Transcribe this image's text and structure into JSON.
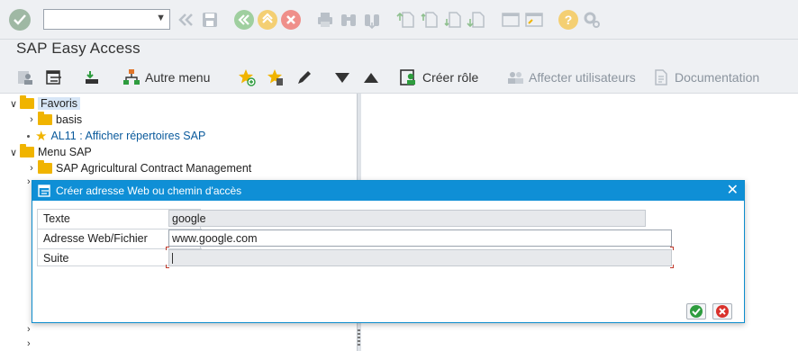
{
  "app": {
    "title": "SAP Easy Access"
  },
  "systoolbar": {
    "command_value": "",
    "icons": [
      "enter-icon",
      "back-icon",
      "save-icon",
      "back-green-icon",
      "exit-icon",
      "cancel-icon",
      "print-icon",
      "find-icon",
      "find-next-icon",
      "first-page-icon",
      "prev-page-icon",
      "next-page-icon",
      "last-page-icon",
      "new-session-icon",
      "shortcut-icon",
      "help-icon",
      "settings-icon"
    ]
  },
  "apptoolbar": {
    "autre_menu": "Autre menu",
    "creer_role": "Créer rôle",
    "affecter_utilisateurs": "Affecter utilisateurs",
    "documentation": "Documentation"
  },
  "tree": {
    "favoris": "Favoris",
    "basis": "basis",
    "al11": "AL11 : Afficher répertoires SAP",
    "menu_sap": "Menu SAP",
    "agricultural": "SAP Agricultural Contract Management"
  },
  "dialog": {
    "title": "Créer adresse Web ou chemin d'accès",
    "close": "✕",
    "fields": {
      "texte_label": "Texte",
      "texte_value": "google",
      "adresse_label": "Adresse Web/Fichier",
      "adresse_value": "www.google.com",
      "suite_label": "Suite",
      "suite_value": ""
    }
  },
  "colors": {
    "accent": "#0f8fd6",
    "folder": "#f0b400",
    "ok": "#2e9c3e",
    "cancel": "#d9312b"
  }
}
